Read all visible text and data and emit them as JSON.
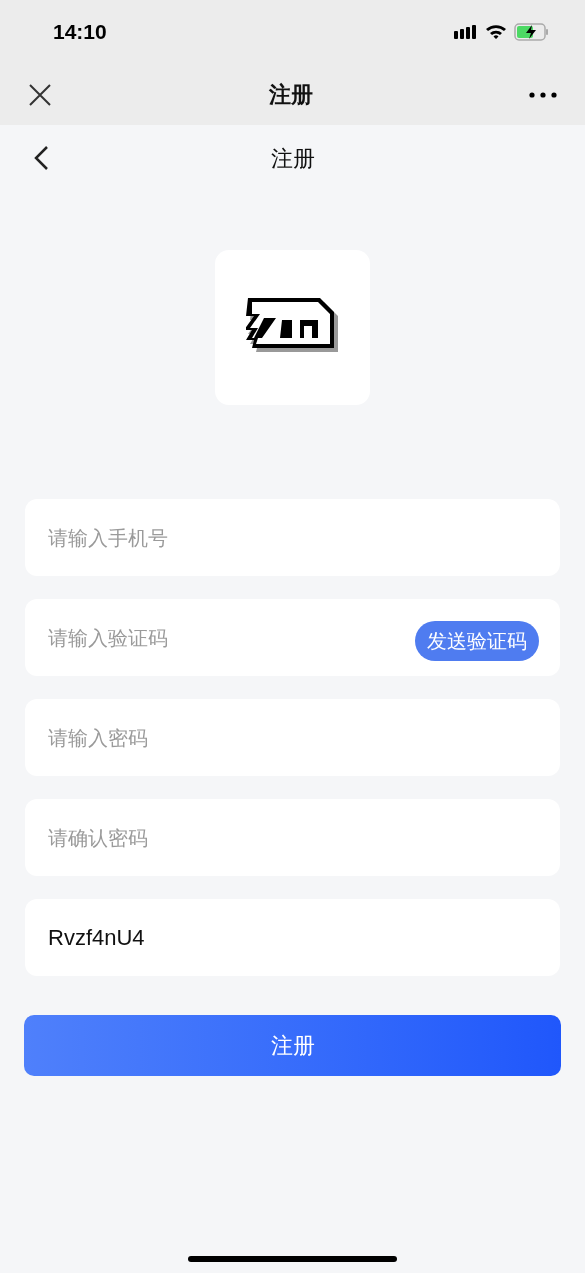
{
  "status_bar": {
    "time": "14:10"
  },
  "top_bar": {
    "title": "注册"
  },
  "header": {
    "title": "注册"
  },
  "fields": [
    {
      "kind": "input",
      "placeholder": "请输入手机号"
    },
    {
      "kind": "code",
      "placeholder": "请输入验证码",
      "button": "发送验证码"
    },
    {
      "kind": "input",
      "placeholder": "请输入密码"
    },
    {
      "kind": "input",
      "placeholder": "请确认密码"
    },
    {
      "kind": "input",
      "value": "Rvzf4nU4"
    }
  ],
  "submit": "注册"
}
